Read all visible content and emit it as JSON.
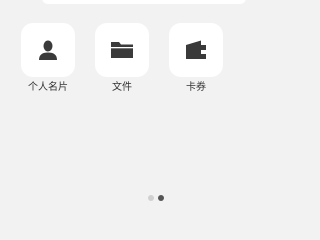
{
  "apps": [
    {
      "label": "个人名片",
      "icon": "person-icon"
    },
    {
      "label": "文件",
      "icon": "folder-icon"
    },
    {
      "label": "卡券",
      "icon": "wallet-icon"
    }
  ],
  "pager": {
    "total": 2,
    "current": 2
  },
  "colors": {
    "background": "#f2f2f2",
    "tile": "#ffffff",
    "icon": "#3a3a3a"
  }
}
